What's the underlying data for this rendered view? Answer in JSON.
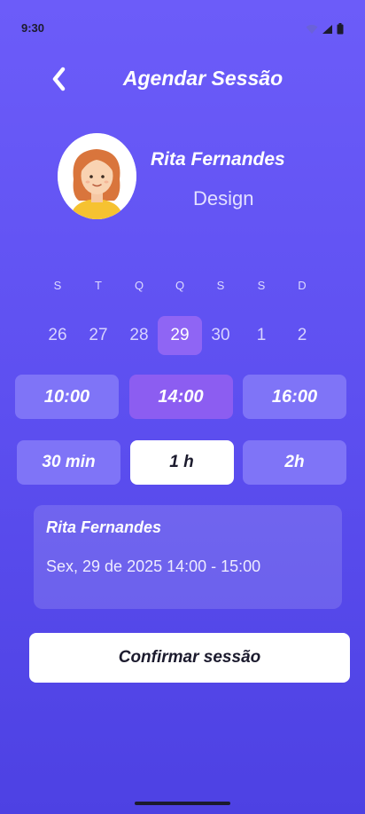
{
  "status_bar": {
    "time": "9:30",
    "icons": [
      "wifi-icon",
      "signal-icon",
      "battery-icon"
    ]
  },
  "header": {
    "back_icon": "chevron-left-icon",
    "title": "Agendar Sessão"
  },
  "profile": {
    "name": "Rita Fernandes",
    "role": "Design"
  },
  "calendar": {
    "weekdays": [
      "S",
      "T",
      "Q",
      "Q",
      "S",
      "S",
      "D"
    ],
    "dates": [
      "26",
      "27",
      "28",
      "29",
      "30",
      "1",
      "2"
    ],
    "selected_date": "29"
  },
  "time_slots": {
    "options": [
      "10:00",
      "14:00",
      "16:00"
    ],
    "selected": "14:00"
  },
  "durations": {
    "options": [
      "30 min",
      "1 h",
      "2h"
    ],
    "selected": "1 h"
  },
  "summary": {
    "name": "Rita Fernandes",
    "datetime": "Sex, 29 de 2025 14:00 - 15:00"
  },
  "confirm_label": "Confirmar sessão",
  "colors": {
    "background_top": "#6c5cf9",
    "background_bottom": "#4d41e3",
    "accent_selected": "#8c5df1",
    "chip": "#7f74f7"
  }
}
